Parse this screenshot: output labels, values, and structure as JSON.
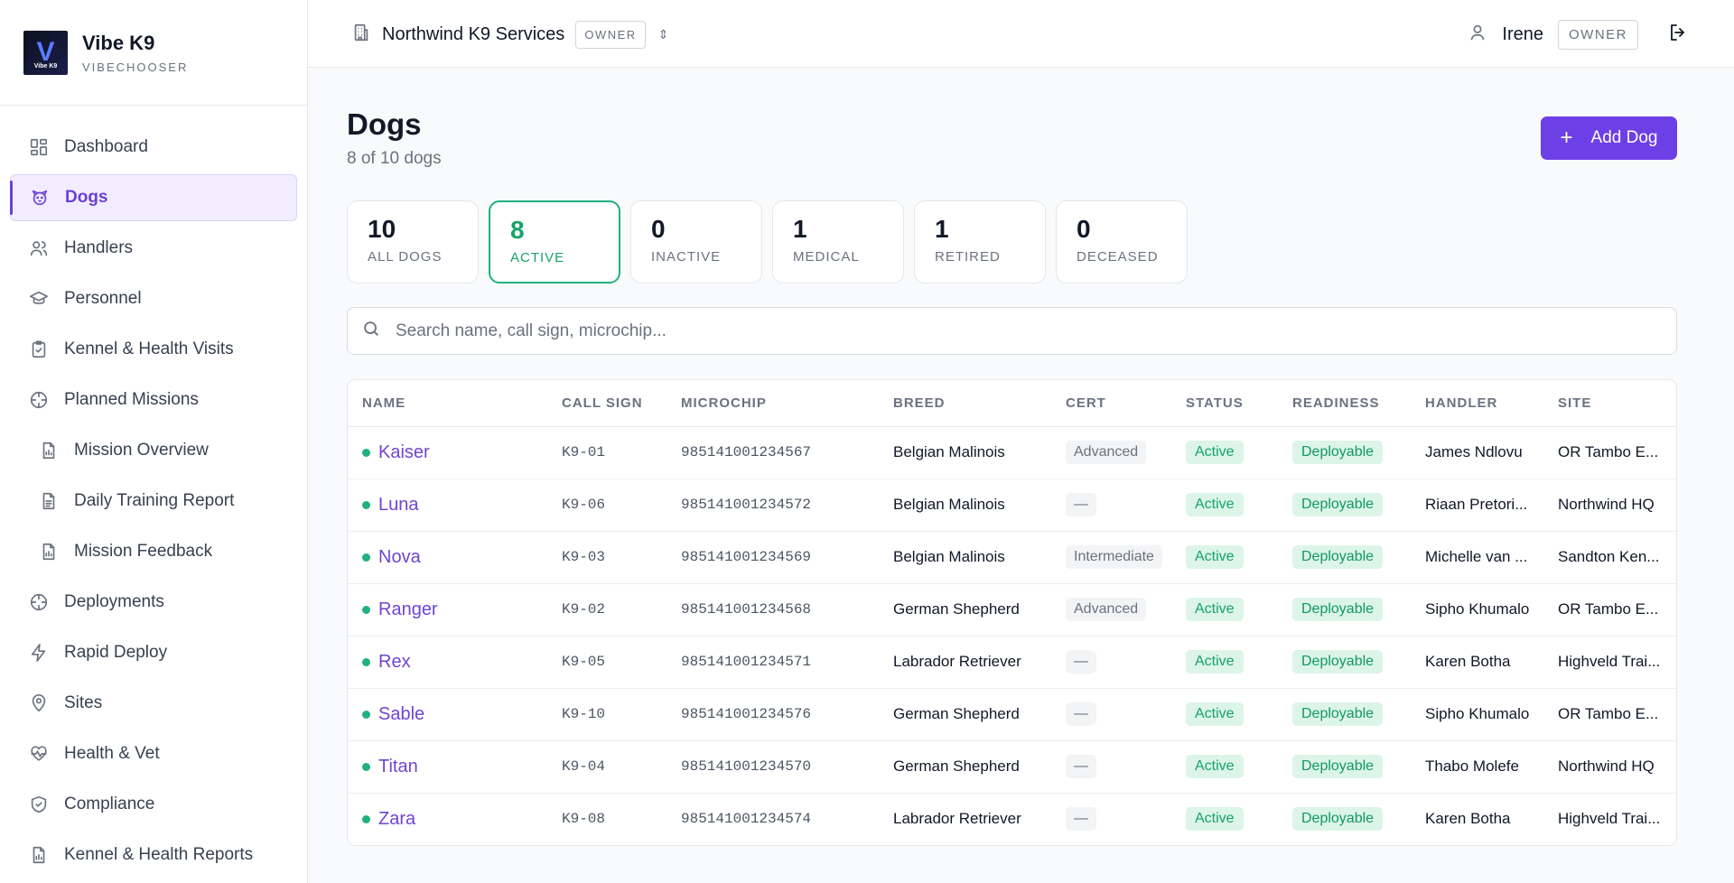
{
  "brand": {
    "title": "Vibe K9",
    "subtitle": "VIBECHOOSER",
    "logo_text": "Vibe K9"
  },
  "nav": [
    {
      "label": "Dashboard",
      "icon": "dashboard-icon",
      "sub": false,
      "active": false
    },
    {
      "label": "Dogs",
      "icon": "dog-icon",
      "sub": false,
      "active": true
    },
    {
      "label": "Handlers",
      "icon": "users-icon",
      "sub": false,
      "active": false
    },
    {
      "label": "Personnel",
      "icon": "graduation-cap-icon",
      "sub": false,
      "active": false
    },
    {
      "label": "Kennel & Health Visits",
      "icon": "clipboard-check-icon",
      "sub": false,
      "active": false
    },
    {
      "label": "Planned Missions",
      "icon": "crosshair-icon",
      "sub": false,
      "active": false
    },
    {
      "label": "Mission Overview",
      "icon": "file-chart-icon",
      "sub": true,
      "active": false
    },
    {
      "label": "Daily Training Report",
      "icon": "file-text-icon",
      "sub": true,
      "active": false
    },
    {
      "label": "Mission Feedback",
      "icon": "file-chart-icon",
      "sub": true,
      "active": false
    },
    {
      "label": "Deployments",
      "icon": "crosshair-icon",
      "sub": false,
      "active": false
    },
    {
      "label": "Rapid Deploy",
      "icon": "lightning-icon",
      "sub": false,
      "active": false
    },
    {
      "label": "Sites",
      "icon": "map-pin-icon",
      "sub": false,
      "active": false
    },
    {
      "label": "Health & Vet",
      "icon": "heart-pulse-icon",
      "sub": false,
      "active": false
    },
    {
      "label": "Compliance",
      "icon": "shield-check-icon",
      "sub": false,
      "active": false
    },
    {
      "label": "Kennel & Health Reports",
      "icon": "file-chart-icon",
      "sub": false,
      "active": false
    }
  ],
  "topbar": {
    "org_name": "Northwind K9 Services",
    "org_role": "OWNER",
    "user_name": "Irene",
    "user_role": "OWNER"
  },
  "page": {
    "title": "Dogs",
    "subtitle": "8 of 10 dogs",
    "add_label": "Add Dog"
  },
  "cards": [
    {
      "count": "10",
      "label": "ALL DOGS",
      "active": false
    },
    {
      "count": "8",
      "label": "ACTIVE",
      "active": true
    },
    {
      "count": "0",
      "label": "INACTIVE",
      "active": false
    },
    {
      "count": "1",
      "label": "MEDICAL",
      "active": false
    },
    {
      "count": "1",
      "label": "RETIRED",
      "active": false
    },
    {
      "count": "0",
      "label": "DECEASED",
      "active": false
    }
  ],
  "search": {
    "placeholder": "Search name, call sign, microchip..."
  },
  "table": {
    "columns": [
      "NAME",
      "CALL SIGN",
      "MICROCHIP",
      "BREED",
      "CERT",
      "STATUS",
      "READINESS",
      "HANDLER",
      "SITE"
    ],
    "rows": [
      {
        "name": "Kaiser",
        "call_sign": "K9-01",
        "microchip": "985141001234567",
        "breed": "Belgian Malinois",
        "cert": "Advanced",
        "status": "Active",
        "readiness": "Deployable",
        "handler": "James Ndlovu",
        "site": "OR Tambo E..."
      },
      {
        "name": "Luna",
        "call_sign": "K9-06",
        "microchip": "985141001234572",
        "breed": "Belgian Malinois",
        "cert": "—",
        "status": "Active",
        "readiness": "Deployable",
        "handler": "Riaan Pretori...",
        "site": "Northwind HQ"
      },
      {
        "name": "Nova",
        "call_sign": "K9-03",
        "microchip": "985141001234569",
        "breed": "Belgian Malinois",
        "cert": "Intermediate",
        "status": "Active",
        "readiness": "Deployable",
        "handler": "Michelle van ...",
        "site": "Sandton Ken..."
      },
      {
        "name": "Ranger",
        "call_sign": "K9-02",
        "microchip": "985141001234568",
        "breed": "German Shepherd",
        "cert": "Advanced",
        "status": "Active",
        "readiness": "Deployable",
        "handler": "Sipho Khumalo",
        "site": "OR Tambo E..."
      },
      {
        "name": "Rex",
        "call_sign": "K9-05",
        "microchip": "985141001234571",
        "breed": "Labrador Retriever",
        "cert": "—",
        "status": "Active",
        "readiness": "Deployable",
        "handler": "Karen Botha",
        "site": "Highveld Trai..."
      },
      {
        "name": "Sable",
        "call_sign": "K9-10",
        "microchip": "985141001234576",
        "breed": "German Shepherd",
        "cert": "—",
        "status": "Active",
        "readiness": "Deployable",
        "handler": "Sipho Khumalo",
        "site": "OR Tambo E..."
      },
      {
        "name": "Titan",
        "call_sign": "K9-04",
        "microchip": "985141001234570",
        "breed": "German Shepherd",
        "cert": "—",
        "status": "Active",
        "readiness": "Deployable",
        "handler": "Thabo Molefe",
        "site": "Northwind HQ"
      },
      {
        "name": "Zara",
        "call_sign": "K9-08",
        "microchip": "985141001234574",
        "breed": "Labrador Retriever",
        "cert": "—",
        "status": "Active",
        "readiness": "Deployable",
        "handler": "Karen Botha",
        "site": "Highveld Trai..."
      }
    ]
  },
  "colors": {
    "accent": "#6d3fe6",
    "active_green": "#22b07d"
  }
}
